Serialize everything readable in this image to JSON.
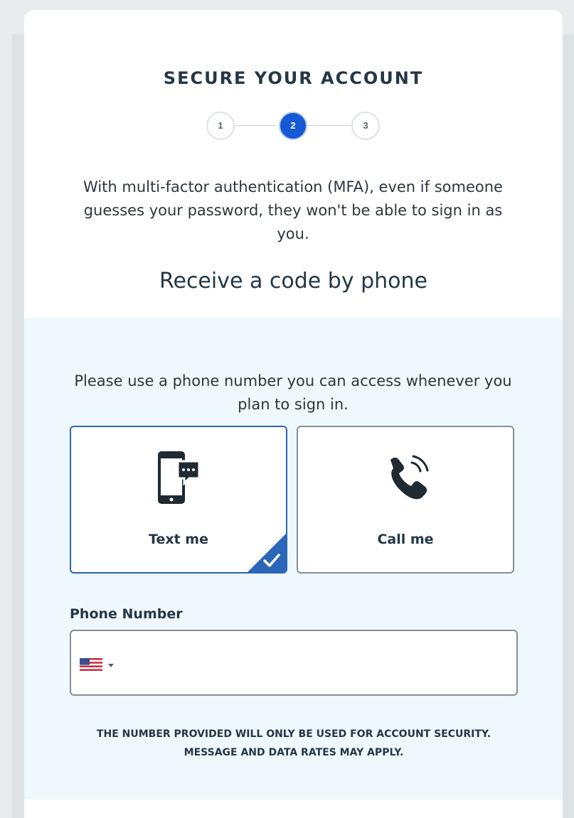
{
  "header": {
    "title": "SECURE YOUR ACCOUNT"
  },
  "stepper": {
    "steps": [
      "1",
      "2",
      "3"
    ],
    "active_step": 2
  },
  "intro": {
    "text": "With multi-factor authentication (MFA), even if someone guesses your password, they won't be able to sign in as you."
  },
  "method": {
    "subtitle": "Receive a code by phone",
    "hint": "Please use a phone number you can access whenever you plan to sign in.",
    "options": [
      {
        "label": "Text me",
        "icon": "mobile-message-icon",
        "selected": true
      },
      {
        "label": "Call me",
        "icon": "phone-call-icon",
        "selected": false
      }
    ]
  },
  "phone": {
    "label": "Phone Number",
    "country_icon": "us-flag-icon",
    "value": "",
    "disclaimer": "THE NUMBER PROVIDED WILL ONLY BE USED FOR ACCOUNT SECURITY. MESSAGE AND DATA RATES MAY APPLY."
  },
  "colors": {
    "accent": "#1659d4",
    "selected_border": "#2c66b8",
    "section_background": "#eff8fc",
    "text": "#253746"
  }
}
